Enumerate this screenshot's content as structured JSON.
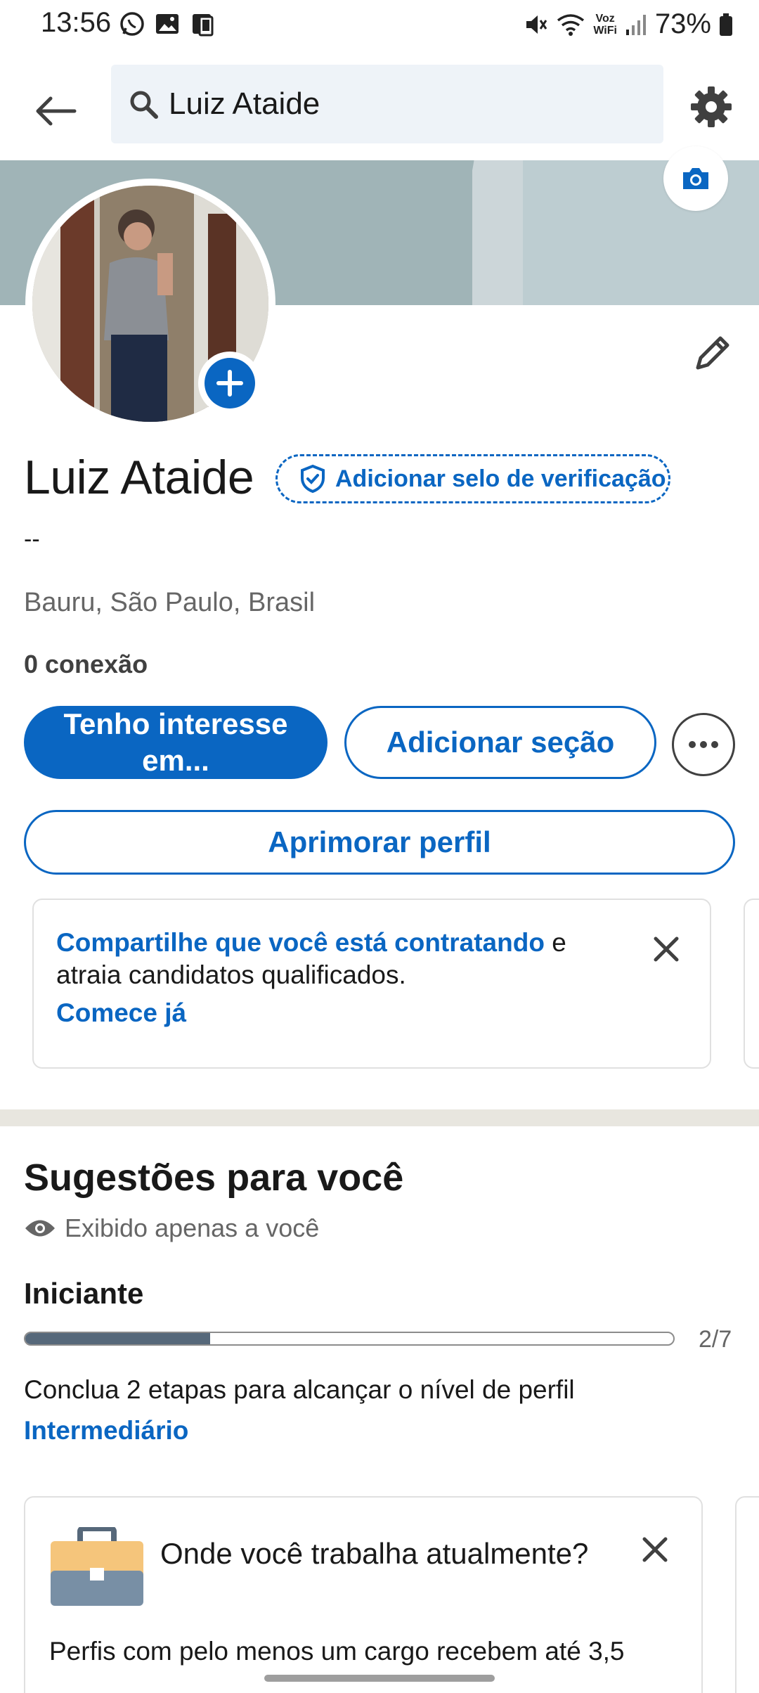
{
  "status_bar": {
    "time": "13:56",
    "battery": "73%",
    "voz_wifi_line1": "Voz",
    "voz_wifi_line2": "WiFi"
  },
  "top_bar": {
    "search_value": "Luiz Ataide"
  },
  "profile": {
    "name": "Luiz Ataide",
    "verify_label": "Adicionar selo de verificação",
    "headline": "--",
    "location": "Bauru, São Paulo, Brasil",
    "connections": "0 conexão"
  },
  "actions": {
    "interest_label": "Tenho interesse em...",
    "add_section_label": "Adicionar seção",
    "improve_label": "Aprimorar perfil"
  },
  "hiring_card": {
    "highlight": "Compartilhe que você está contratando",
    "rest": " e atraia candidatos qualificados.",
    "cta": "Comece já"
  },
  "suggestions": {
    "title": "Sugestões para você",
    "private_note": "Exibido apenas a você",
    "level": "Iniciante",
    "progress_fraction": 0.2857,
    "progress_text": "2/7",
    "description": "Conclua 2 etapas para alcançar o nível de perfil",
    "next_level": "Intermediário"
  },
  "job_card": {
    "title": "Onde você trabalha atualmente?",
    "description": "Perfis com pelo menos um cargo recebem até 3,5"
  },
  "colors": {
    "brand_blue": "#0a66c2",
    "cover": "#a0b4b7",
    "progress_fill": "#56687a"
  },
  "icons": [
    "back-arrow-icon",
    "search-icon",
    "gear-icon",
    "camera-icon",
    "plus-icon",
    "pencil-icon",
    "shield-check-icon",
    "more-icon",
    "close-icon",
    "eye-icon",
    "briefcase-icon"
  ]
}
